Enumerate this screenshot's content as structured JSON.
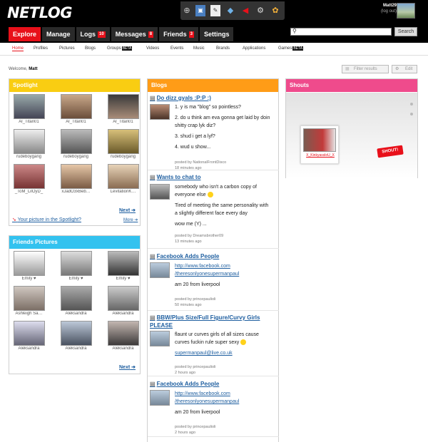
{
  "header": {
    "logo": "NETLOG",
    "user": {
      "name": "Matt29",
      "logout": "(log out)"
    }
  },
  "main_nav": [
    {
      "label": "Explore",
      "badge": ""
    },
    {
      "label": "Manage",
      "badge": ""
    },
    {
      "label": "Logs",
      "badge": "10"
    },
    {
      "label": "Messages",
      "badge": "8"
    },
    {
      "label": "Friends",
      "badge": "3"
    },
    {
      "label": "Settings",
      "badge": ""
    }
  ],
  "search": {
    "placeholder": "",
    "button": "Search"
  },
  "sub_nav": [
    "Home",
    "Profiles",
    "Pictures",
    "Blogs",
    "Groups",
    "Videos",
    "Events",
    "Music",
    "Brands",
    "Applications",
    "Games"
  ],
  "beta_label": "BETA",
  "welcome": {
    "prefix": "Welcome,",
    "name": "Matt"
  },
  "toolbar": {
    "filter": "Filter results",
    "edit": "Edit"
  },
  "spotlight": {
    "title": "Spotlight",
    "items": [
      "Al_Titan01",
      "Al_Titan01",
      "Al_Titan01",
      "rudeboygang",
      "rudeboygang",
      "rudeboygang",
      "_ToM_LilOyD_",
      "xJadO3xBeb…",
      "LevitationK…"
    ],
    "next": "Next",
    "more": "More",
    "link": "Your picture in the Spotlight?"
  },
  "friends_pictures": {
    "title": "Friends Pictures",
    "items": [
      "Emily ♥",
      "Emily ♥",
      "Emily ♥",
      "Ashleigh Sa…",
      "Aleksandra",
      "Aleksandra",
      "Aleksandra",
      "Aleksandra",
      "Aleksandra"
    ],
    "next": "Next"
  },
  "blogs": {
    "title": "Blogs",
    "posts": [
      {
        "title": "Do dizz gyals :P:P :)",
        "lines": [
          "1. y is ma \"blog\" so pointless?",
          "2. do u think am eva gonna get laid by doin",
          "shitty crap lyk diz?",
          "3. shud i get a lyf?",
          "4. wud u show..."
        ],
        "author": "posted by NationalFrontDisco",
        "time": "18 minutes ago"
      },
      {
        "title": "Wants to chat to",
        "lines": [
          "somebody who isn't a carbon copy of",
          "everyone else",
          "Tired of meeting the same personality with",
          "a slightly different face every day",
          "wow me (Y) ..."
        ],
        "author": "posted by Dreamsbrother09",
        "time": "13 minutes ago"
      },
      {
        "title": "Facebook Adds People",
        "lines": [
          "http://www.facebook.com",
          "/theresonlyonesupermanpaul",
          "am 20 from liverpool"
        ],
        "author": "posted by princepaulioli",
        "time": "50 minutes ago"
      },
      {
        "title": "BBW/Plus Size/Full Figure/Curvy Girls PLEASE",
        "lines": [
          "flaunt ur curves girls of all sizes cause",
          "curves fuckin rule super sexy",
          "supermanpaul@live.co.uk"
        ],
        "author": "posted by princepaulioli",
        "time": "2 hours ago"
      },
      {
        "title": "Facebook Adds People",
        "lines": [
          "http://www.facebook.com",
          "/theresonlyonesupermanpaul",
          "am 20 from liverpool"
        ],
        "author": "posted by princepaulioli",
        "time": "2 hours ago"
      }
    ]
  },
  "shouts": {
    "title": "Shouts",
    "user": "X_KinkyassloU_X",
    "button": "SHOUT!"
  }
}
